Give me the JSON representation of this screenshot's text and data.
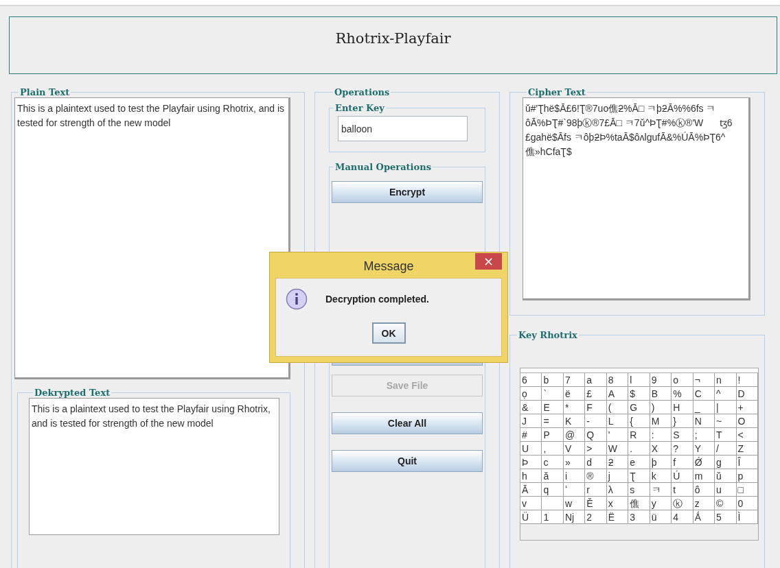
{
  "title": "Rhotrix-Playfair",
  "plain_text": {
    "label": "Plain Text",
    "value": "This is a plaintext used to test the Playfair using Rhotrix, and is tested for strength of the new model"
  },
  "dekrypted_text": {
    "label": "Dekrypted Text",
    "value": "This is a plaintext used to test the Playfair using Rhotrix, and is tested for strength of the new model"
  },
  "operations": {
    "label": "Operations",
    "key": {
      "label": "Enter Key",
      "value": "balloon"
    },
    "manual": {
      "label": "Manual Operations",
      "buttons": [
        {
          "kind": "button",
          "label": "Encrypt",
          "disabled": false
        },
        {
          "kind": "covered"
        },
        {
          "kind": "button",
          "label": "Save File",
          "disabled": true
        },
        {
          "kind": "button",
          "label": "Clear All",
          "disabled": false
        },
        {
          "kind": "button",
          "label": "Quit",
          "disabled": false
        }
      ]
    }
  },
  "cipher_text": {
    "label": "Cipher Text",
    "value": "ǔ#'Ʈhë$Ā£6!Ʈ®7uo僬ƻ%Ā□ ㅋþƻĀ%%6fs ㅋôĀ%ÞƮ#`98þⓚ®7£Ā□ ㅋ7ǔ^ÞƮ#%ⓚ®'W      ꜩ6 £gahë$Āfs ㅋôþƻÞ%taĀ$ôʌlgufĀ&%ÚĀ%ÞƮ6^ 僬»hCfaƮ$"
  },
  "key_rhotrix": {
    "label": "Key Rhotrix",
    "rows": [
      [
        "6",
        "b",
        "7",
        "a",
        "8",
        "l",
        "9",
        "o",
        "¬",
        "n",
        "!"
      ],
      [
        "ọ",
        "`",
        "ë",
        "£",
        "A",
        "$",
        "B",
        "%",
        "C",
        "^",
        "D"
      ],
      [
        "&",
        "E",
        "*",
        "F",
        "(",
        "G",
        ")",
        "H",
        "_",
        "|",
        "+"
      ],
      [
        "J",
        "=",
        "K",
        "-",
        "L",
        "{",
        "M",
        "}",
        "N",
        "~",
        "O"
      ],
      [
        "#",
        "P",
        "@",
        "Q",
        "'",
        "R",
        ":",
        "S",
        ";",
        "T",
        "<"
      ],
      [
        "U",
        ",",
        "V",
        ">",
        "W",
        ".",
        "X",
        "?",
        "Y",
        "/",
        "Z"
      ],
      [
        "Þ",
        "c",
        "»",
        "d",
        "ƻ",
        "e",
        "þ",
        "f",
        "Ǿ",
        "g",
        "Î"
      ],
      [
        "h",
        "ă",
        "i",
        "®",
        "j",
        "Ʈ",
        "k",
        "Ú",
        "m",
        "ǔ",
        "p"
      ],
      [
        "Ā",
        "q",
        "ʻ",
        "r",
        "λ",
        "s",
        "ㅋ",
        "t",
        "ô",
        "u",
        "□"
      ],
      [
        "v",
        null,
        "w",
        "Ě",
        "x",
        "僬",
        "y",
        "ⓚ",
        "z",
        "©",
        "0"
      ],
      [
        "Ü",
        "1",
        "Nj",
        "2",
        "Ë",
        "3",
        "ü",
        "4",
        "Ǻ",
        "5",
        "Ì"
      ]
    ]
  },
  "dialog": {
    "title": "Message",
    "message": "Decryption completed.",
    "button": "OK",
    "close": "×"
  }
}
